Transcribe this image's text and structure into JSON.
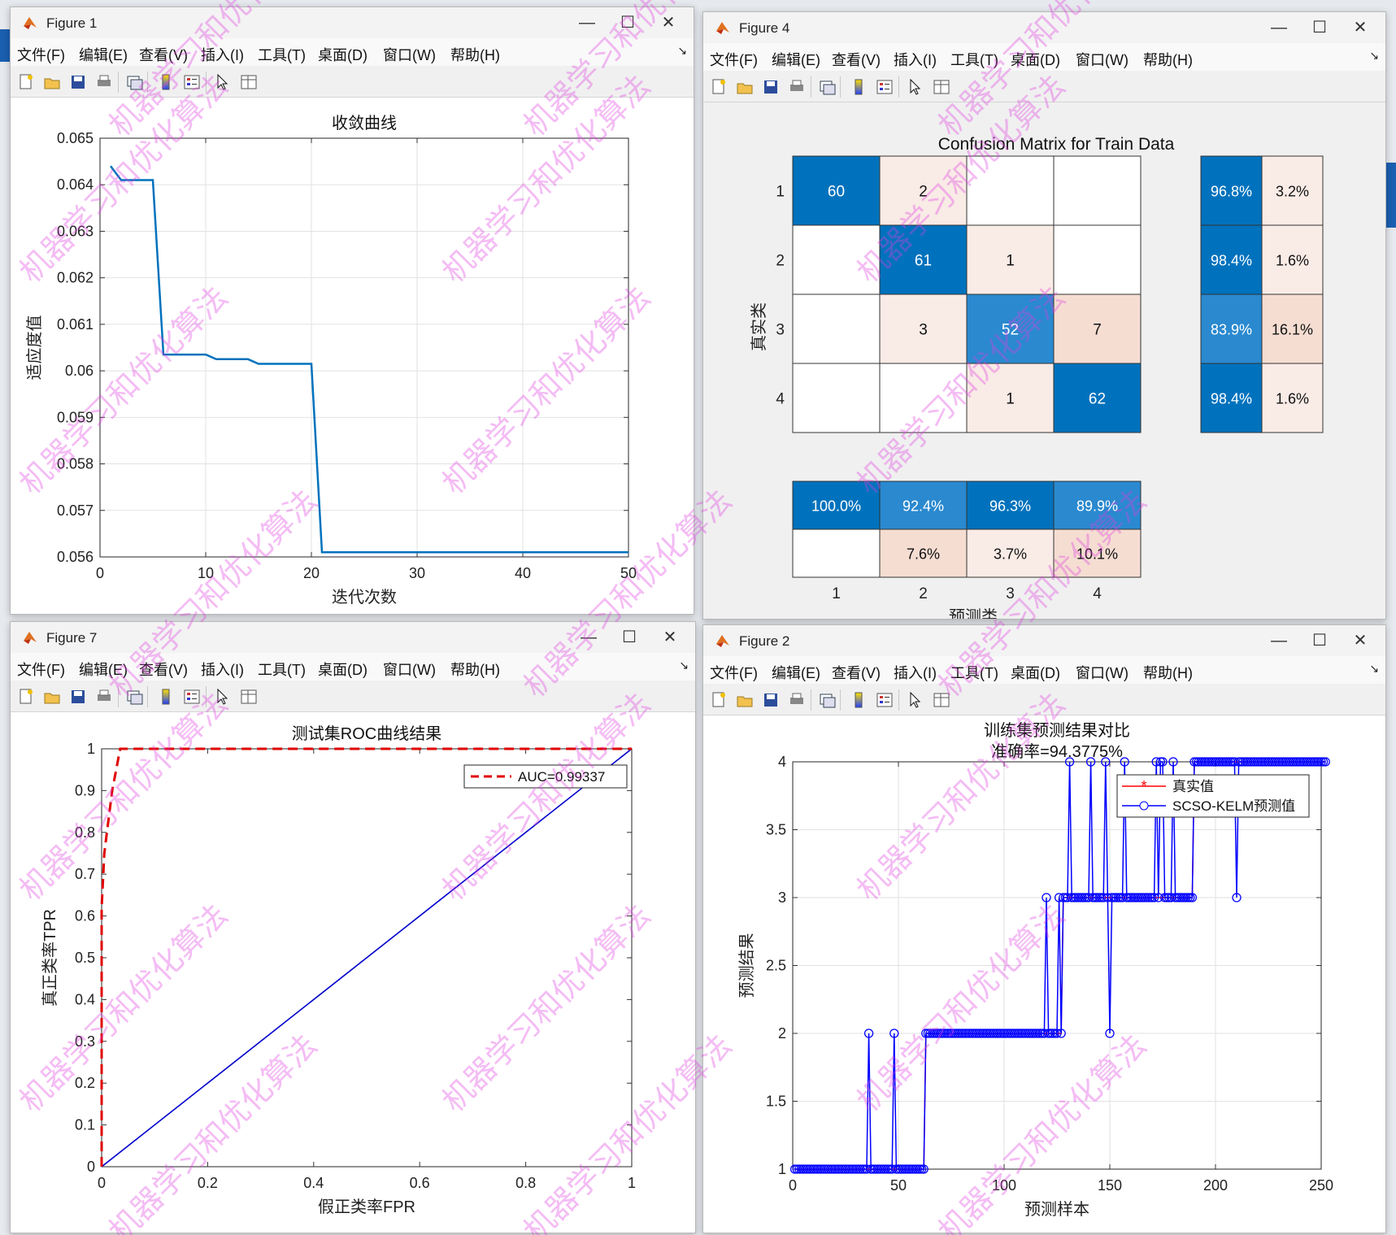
{
  "menu_items": [
    "文件(F)",
    "编辑(E)",
    "查看(V)",
    "插入(I)",
    "工具(T)",
    "桌面(D)",
    "窗口(W)",
    "帮助(H)"
  ],
  "window_controls": {
    "minimize": "—",
    "maximize": "☐",
    "close": "✕"
  },
  "toolbar_icons": [
    "new-figure-icon",
    "open-file-icon",
    "save-icon",
    "print-icon",
    "link-plot-icon",
    "insert-colorbar-icon",
    "insert-legend-icon",
    "edit-pointer-icon",
    "property-inspector-icon"
  ],
  "watermark": "机器学习和优化算法",
  "colors": {
    "line_blue": "#0072bd",
    "roc_red": "#e00000",
    "roc_blue": "#0000cc",
    "pred_blue": "#0000ff",
    "true_red": "#ff0000",
    "cm_dark": "#0072bd",
    "cm_mid": "#2a89cf",
    "cm_light": "#f9ebe6",
    "cm_peach": "#f5ddd2",
    "watermark": "#e040e0"
  },
  "windows": {
    "fig1": {
      "title": "Figure 1",
      "chart_data": {
        "type": "line",
        "title": "收敛曲线",
        "xlabel": "迭代次数",
        "ylabel": "适应度值",
        "xlim": [
          0,
          50
        ],
        "ylim": [
          0.056,
          0.065
        ],
        "xticks": [
          "0",
          "10",
          "20",
          "30",
          "40",
          "50"
        ],
        "yticks": [
          "0.056",
          "0.057",
          "0.058",
          "0.059",
          "0.06",
          "0.061",
          "0.062",
          "0.063",
          "0.064",
          "0.065"
        ],
        "grid": true,
        "x": [
          1,
          2,
          3,
          4,
          5,
          6,
          7,
          8,
          9,
          10,
          11,
          12,
          13,
          14,
          15,
          16,
          17,
          18,
          19,
          20,
          21,
          22,
          50
        ],
        "y": [
          0.0644,
          0.0641,
          0.0641,
          0.0641,
          0.0641,
          0.06035,
          0.06035,
          0.06035,
          0.06035,
          0.06035,
          0.06025,
          0.06025,
          0.06025,
          0.06025,
          0.06015,
          0.06015,
          0.06015,
          0.06015,
          0.06015,
          0.06015,
          0.0561,
          0.0561,
          0.0561
        ]
      }
    },
    "fig4": {
      "title": "Figure 4",
      "chart_data": {
        "type": "heatmap",
        "title": "Confusion Matrix for Train Data",
        "xlabel": "预测类",
        "ylabel": "真实类",
        "classes": [
          "1",
          "2",
          "3",
          "4"
        ],
        "matrix": [
          [
            60,
            2,
            null,
            null
          ],
          [
            null,
            61,
            1,
            null
          ],
          [
            null,
            3,
            52,
            7
          ],
          [
            null,
            null,
            1,
            62
          ]
        ],
        "row_summary": [
          [
            "96.8%",
            "3.2%"
          ],
          [
            "98.4%",
            "1.6%"
          ],
          [
            "83.9%",
            "16.1%"
          ],
          [
            "98.4%",
            "1.6%"
          ]
        ],
        "col_summary": [
          [
            "100.0%",
            "92.4%",
            "96.3%",
            "89.9%"
          ],
          [
            "",
            "7.6%",
            "3.7%",
            "10.1%"
          ]
        ]
      }
    },
    "fig7": {
      "title": "Figure 7",
      "chart_data": {
        "type": "line",
        "title": "测试集ROC曲线结果",
        "xlabel": "假正类率FPR",
        "ylabel": "真正类率TPR",
        "xlim": [
          0,
          1
        ],
        "ylim": [
          0,
          1
        ],
        "xticks": [
          "0",
          "0.2",
          "0.4",
          "0.6",
          "0.8",
          "1"
        ],
        "yticks": [
          "0",
          "0.1",
          "0.2",
          "0.3",
          "0.4",
          "0.5",
          "0.6",
          "0.7",
          "0.8",
          "0.9",
          "1"
        ],
        "legend": "top-right",
        "series": [
          {
            "name": "AUC=0.99337",
            "style": "dashed-red",
            "x": [
              0,
              0,
              0.005,
              0.01,
              0.02,
              0.035,
              1
            ],
            "y": [
              0,
              0.62,
              0.75,
              0.8,
              0.9,
              1.0,
              1.0
            ]
          },
          {
            "style": "solid-blue",
            "x": [
              0,
              1
            ],
            "y": [
              0,
              1
            ]
          }
        ]
      }
    },
    "fig2": {
      "title": "Figure 2",
      "chart_data": {
        "type": "line",
        "title": "训练集预测结果对比",
        "subtitle": "准确率=94.3775%",
        "xlabel": "预测样本",
        "ylabel": "预测结果",
        "xlim": [
          0,
          250
        ],
        "ylim": [
          1,
          4
        ],
        "xticks": [
          "0",
          "50",
          "100",
          "150",
          "200",
          "250"
        ],
        "yticks": [
          "1",
          "1.5",
          "2",
          "2.5",
          "3",
          "3.5",
          "4"
        ],
        "legend": "top-right",
        "series": [
          {
            "name": "真实值",
            "marker": "*",
            "color": "red",
            "class_ranges": [
              [
                1,
                62,
                1
              ],
              [
                63,
                127,
                2
              ],
              [
                128,
                189,
                3
              ],
              [
                190,
                252,
                4
              ]
            ]
          },
          {
            "name": "SCSO-KELM预测值",
            "marker": "o",
            "color": "blue",
            "class_ranges": [
              [
                1,
                62,
                1
              ],
              [
                63,
                127,
                2
              ],
              [
                128,
                189,
                3
              ],
              [
                190,
                252,
                4
              ]
            ],
            "overrides": [
              [
                36,
                2
              ],
              [
                48,
                2
              ],
              [
                120,
                3
              ],
              [
                126,
                3
              ],
              [
                131,
                4
              ],
              [
                141,
                4
              ],
              [
                148,
                2
              ],
              [
                150,
                2
              ],
              [
                148,
                4
              ],
              [
                157,
                4
              ],
              [
                172,
                4
              ],
              [
                174,
                4
              ],
              [
                175,
                4
              ],
              [
                180,
                4
              ],
              [
                210,
                3
              ]
            ]
          }
        ]
      }
    }
  }
}
